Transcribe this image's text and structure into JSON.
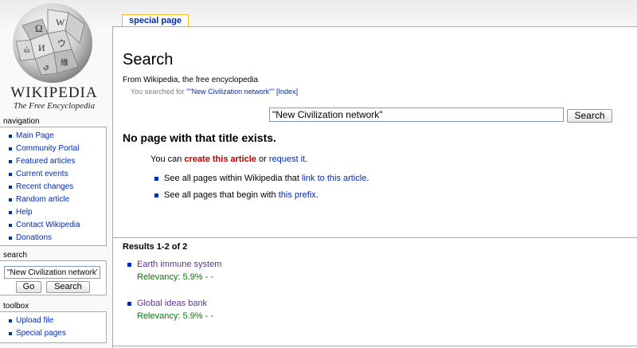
{
  "logo": {
    "title": "WIKIPEDIA",
    "subtitle": "The Free Encyclopedia"
  },
  "tab": {
    "label": "special page"
  },
  "page": {
    "title": "Search",
    "sitesub": "From Wikipedia, the free encyclopedia",
    "searched_prefix": "You searched for ",
    "searched_term": "\"\"New Civilization network\"\"",
    "index_link": "[Index]"
  },
  "search": {
    "query": "\"New Civilization network\"",
    "button": "Search"
  },
  "notice": {
    "heading": "No page with that title exists.",
    "you_can": "You can ",
    "create": "create this article",
    "or": " or ",
    "request": "request it",
    "period": ".",
    "bullet1_text": "See all pages within Wikipedia that ",
    "bullet1_link": "link to this article",
    "bullet2_text": "See all pages that begin with ",
    "bullet2_link": "this prefix"
  },
  "results": {
    "heading": "Results 1-2 of 2",
    "items": [
      {
        "title": "Earth immune system",
        "relevancy": "Relevancy: 5.9% - -"
      },
      {
        "title": "Global ideas bank",
        "relevancy": "Relevancy: 5.9% - -"
      }
    ]
  },
  "sidebar": {
    "navigation_heading": "navigation",
    "navigation": [
      "Main Page",
      "Community Portal",
      "Featured articles",
      "Current events",
      "Recent changes",
      "Random article",
      "Help",
      "Contact Wikipedia",
      "Donations"
    ],
    "search_heading": "search",
    "search_value": "\"New Civilization network\"",
    "go_button": "Go",
    "search_button": "Search",
    "toolbox_heading": "toolbox",
    "toolbox": [
      "Upload file",
      "Special pages"
    ]
  }
}
